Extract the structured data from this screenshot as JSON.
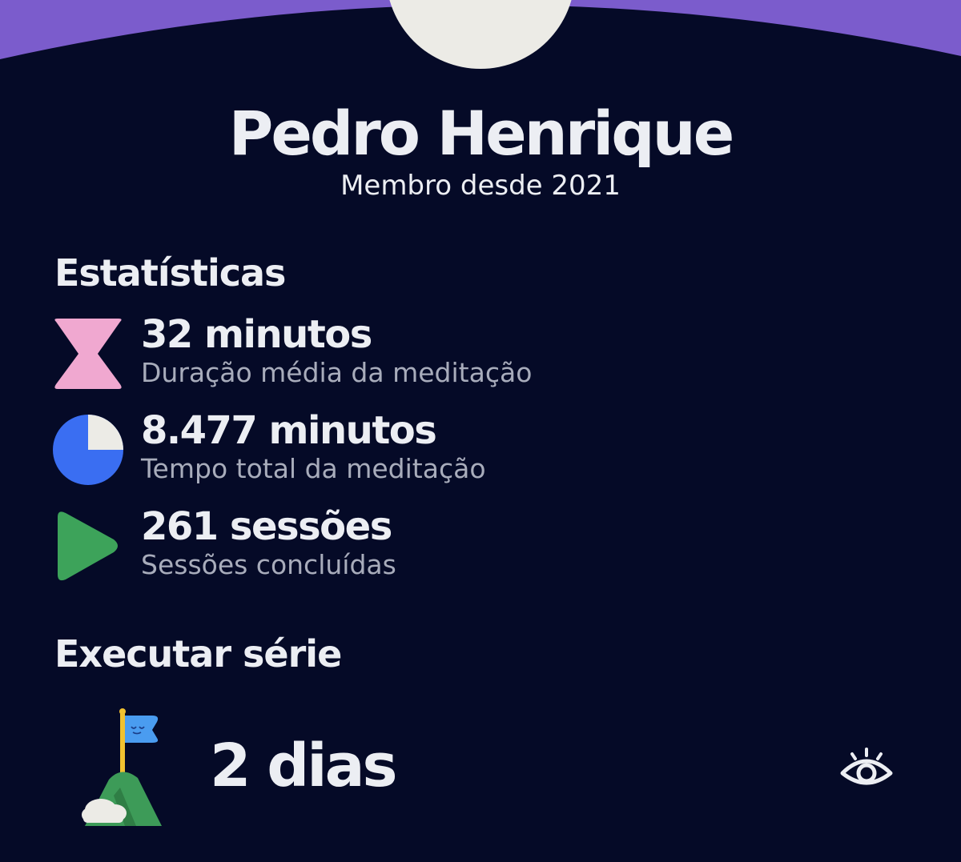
{
  "colors": {
    "background": "#050a27",
    "top_band": "#7b5ccc",
    "text_primary": "#eceef3",
    "text_secondary": "#a8acbb",
    "hourglass": "#f0a8d0",
    "pie_fill": "#3a6ef2",
    "pie_remainder": "#ecebe6",
    "play": "#3da35a"
  },
  "profile": {
    "name": "Pedro Henrique",
    "member_since": "Membro desde 2021"
  },
  "stats": {
    "title": "Estatísticas",
    "items": [
      {
        "icon": "hourglass-icon",
        "value": "32 minutos",
        "label": "Duração média da meditação"
      },
      {
        "icon": "pie-chart-icon",
        "value": "8.477 minutos",
        "label": "Tempo total da meditação"
      },
      {
        "icon": "play-icon",
        "value": "261 sessões",
        "label": "Sessões concluídas"
      }
    ]
  },
  "streak": {
    "title": "Executar série",
    "value": "2 dias",
    "icon": "flag-mountain-icon",
    "toggle_icon": "eye-icon"
  }
}
